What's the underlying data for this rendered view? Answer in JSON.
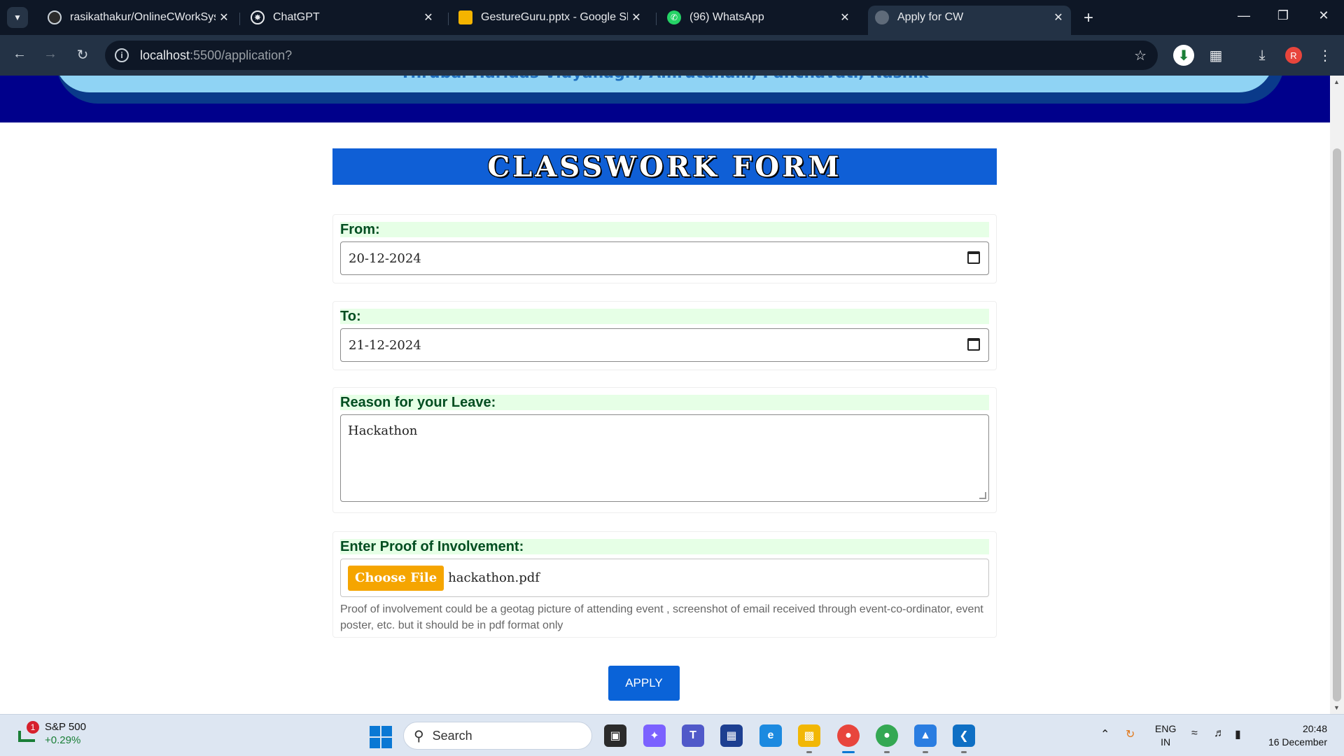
{
  "browser": {
    "tabs": [
      {
        "title": "rasikathakur/OnlineCWorkSyste",
        "icon": "github-icon",
        "active": false
      },
      {
        "title": "ChatGPT",
        "icon": "chatgpt-icon",
        "active": false
      },
      {
        "title": "GestureGuru.pptx - Google Slide",
        "icon": "google-slides-icon",
        "active": false
      },
      {
        "title": "(96) WhatsApp",
        "icon": "whatsapp-icon",
        "active": false
      },
      {
        "title": "Apply for CW",
        "icon": "globe-icon",
        "active": true
      }
    ],
    "url_host": "localhost",
    "url_rest": ":5500/application?",
    "profile_initial": "R"
  },
  "page": {
    "header_subtitle": "Thrubai Haridas Vidyanagri, Amrutdham, Panchavati, Nashik",
    "form_title": "CLASSWORK FORM",
    "from_label": "From:",
    "from_value": "20-12-2024",
    "to_label": "To:",
    "to_value": "21-12-2024",
    "reason_label": "Reason for your Leave:",
    "reason_value": "Hackathon",
    "proof_label": "Enter Proof of Involvement:",
    "choose_file_label": "Choose File",
    "file_name": "hackathon.pdf",
    "proof_help": "Proof of involvement could be a geotag picture of attending event , screenshot of email received through event-co-ordinator, event poster, etc. but it should be in pdf format only",
    "apply_label": "APPLY"
  },
  "taskbar": {
    "widget_badge": "1",
    "widget_title": "S&P 500",
    "widget_change": "+0.29%",
    "search_placeholder": "Search",
    "lang_top": "ENG",
    "lang_bottom": "IN",
    "time": "20:48",
    "date": "16 December"
  },
  "colors": {
    "header_bg": "#00008b",
    "form_title_bg": "#0f5fd6",
    "label_bg": "#e6ffe6",
    "choose_file_bg": "#f5a500",
    "apply_bg": "#0a63d8"
  }
}
